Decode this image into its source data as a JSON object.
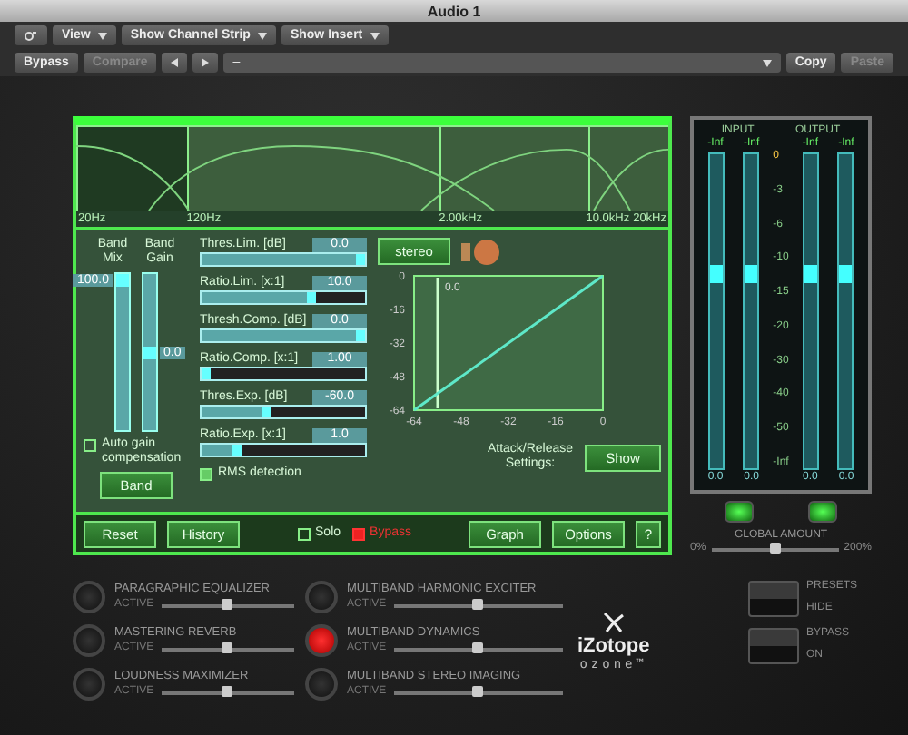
{
  "window": {
    "title": "Audio 1"
  },
  "toolbar": {
    "menus": [
      "View",
      "Show Channel Strip",
      "Show Insert"
    ]
  },
  "preset_bar": {
    "bypass": "Bypass",
    "compare": "Compare",
    "preset": "–",
    "copy": "Copy",
    "paste": "Paste"
  },
  "band_display": {
    "bands": [
      {
        "selected": true
      },
      {
        "selected": false
      },
      {
        "selected": false
      },
      {
        "selected": false
      }
    ],
    "freq_labels": [
      "20Hz",
      "120Hz",
      "2.00kHz",
      "10.0kHz",
      "20kHz"
    ]
  },
  "band_faders": [
    {
      "label": "Band Mix",
      "value": "100.0",
      "level": 1
    },
    {
      "label": "Band Gain",
      "value": "0.0",
      "level": 0.5
    }
  ],
  "auto_gain": {
    "label": "Auto gain compensation",
    "checked": false
  },
  "band_button": "Band",
  "params": [
    {
      "label": "Thres.Lim. [dB]",
      "value": "0.0",
      "level": 1
    },
    {
      "label": "Ratio.Lim. [x:1]",
      "value": "10.0",
      "level": 0.7
    },
    {
      "label": "Thresh.Comp. [dB]",
      "value": "0.0",
      "level": 1
    },
    {
      "label": "Ratio.Comp. [x:1]",
      "value": "1.00",
      "level": 0.05
    },
    {
      "label": "Thres.Exp. [dB]",
      "value": "-60.0",
      "level": 0.42
    },
    {
      "label": "Ratio.Exp. [x:1]",
      "value": "1.0",
      "level": 0.24
    }
  ],
  "rms": {
    "label": "RMS detection",
    "checked": true
  },
  "stereo_button": "stereo",
  "graph": {
    "threshold_readout": "0.0",
    "chart_data": {
      "ref_lines": [
        {
          "axis": "x",
          "value": -56
        }
      ],
      "type": "line",
      "x": [
        -64,
        0
      ],
      "series": [
        {
          "color": "#5ee8c8",
          "values": [
            -64,
            0
          ]
        }
      ],
      "xlim": [
        -64,
        0
      ],
      "ylim": [
        -64,
        0
      ],
      "xticks": [
        -64,
        -48,
        -32,
        -16,
        0
      ],
      "yticks": [
        0,
        -16,
        -32,
        -48,
        -64
      ]
    }
  },
  "attack_release": {
    "label": "Attack/Release Settings:",
    "button": "Show"
  },
  "bottom_bar": {
    "reset": "Reset",
    "history": "History",
    "solo": {
      "label": "Solo",
      "checked": false
    },
    "bypass": {
      "label": "Bypass",
      "checked": true
    },
    "graph": "Graph",
    "options": "Options",
    "help": "?"
  },
  "meters": {
    "input_label": "INPUT",
    "output_label": "OUTPUT",
    "channels": [
      {
        "peak": "-Inf",
        "gain": "0.0",
        "level": 0.62
      },
      {
        "peak": "-Inf",
        "gain": "0.0",
        "level": 0.62
      },
      {
        "peak": "-Inf",
        "gain": "0.0",
        "level": 0.62
      },
      {
        "peak": "-Inf",
        "gain": "0.0",
        "level": 0.62
      }
    ],
    "scale": [
      "0",
      "-3",
      "-6",
      "-10",
      "-15",
      "-20",
      "-30",
      "-40",
      "-50",
      "-Inf"
    ]
  },
  "global_amount": {
    "label": "GLOBAL AMOUNT",
    "min": "0%",
    "max": "200%",
    "level": 0.5
  },
  "modules": [
    {
      "name": "PARAGRAPHIC EQUALIZER",
      "status": "ACTIVE",
      "on": false,
      "level": 0.5
    },
    {
      "name": "MULTIBAND HARMONIC EXCITER",
      "status": "ACTIVE",
      "on": false,
      "level": 0.5
    },
    {
      "name": "MASTERING REVERB",
      "status": "ACTIVE",
      "on": false,
      "level": 0.5
    },
    {
      "name": "MULTIBAND DYNAMICS",
      "status": "ACTIVE",
      "on": true,
      "level": 0.5
    },
    {
      "name": "LOUDNESS MAXIMIZER",
      "status": "ACTIVE",
      "on": false,
      "level": 0.5
    },
    {
      "name": "MULTIBAND STEREO IMAGING",
      "status": "ACTIVE",
      "on": false,
      "level": 0.5
    }
  ],
  "logo": {
    "brand": "iZotope",
    "product": "ozone™"
  },
  "side_switches": [
    {
      "label": "PRESETS",
      "state": "HIDE",
      "on": false
    },
    {
      "label": "BYPASS",
      "state": "ON",
      "on": false
    }
  ]
}
